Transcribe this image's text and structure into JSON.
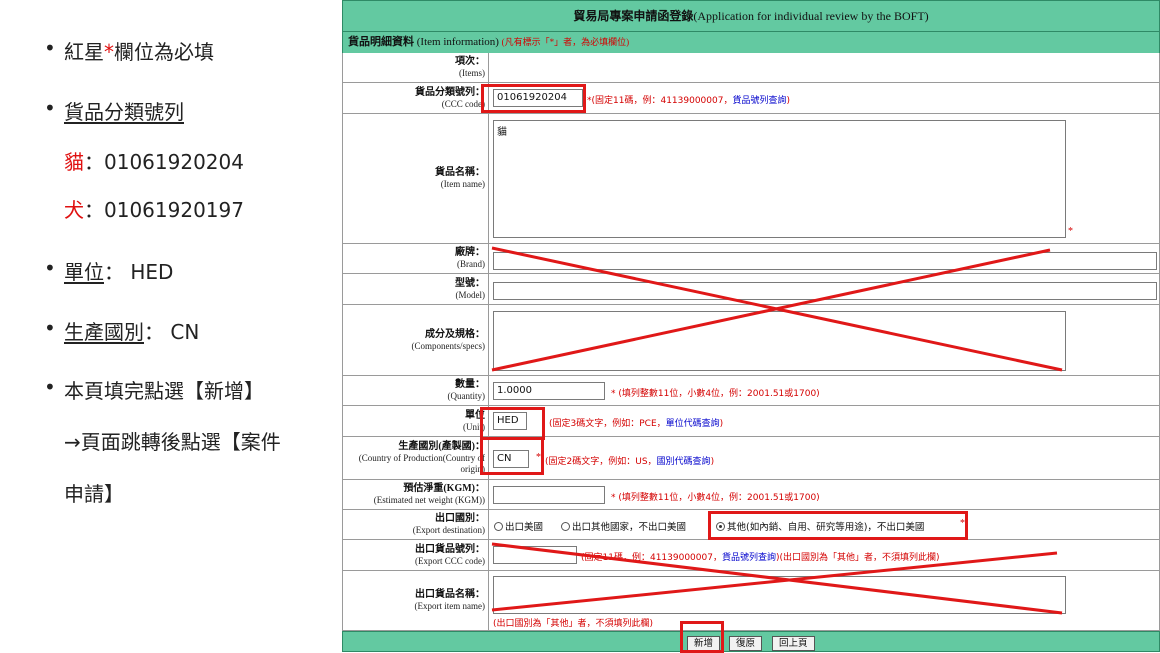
{
  "left": {
    "b1_prefix": "紅星",
    "b1_star": "*",
    "b1_suffix": "欄位為必填",
    "b2": "貨品分類號列",
    "cat_label": "貓",
    "cat_value": "：01061920204",
    "dog_label": "犬",
    "dog_value": "：01061920197",
    "b3_label": "單位",
    "b3_value": "： HED",
    "b4_label": "生產國別",
    "b4_value": "： CN",
    "b5_line1": "本頁填完點選【新增】",
    "b5_line2": "→頁面跳轉後點選【案件",
    "b5_line3": "申請】"
  },
  "form": {
    "title_zh": "貿易局專案申請函登錄",
    "title_en": "(Application for individual review by the BOFT)",
    "section_zh": "貨品明細資料",
    "section_en": "(Item information)",
    "section_note": "(凡有標示「*」者，為必填欄位)",
    "items": {
      "zh": "項次：",
      "en": "(Items)"
    },
    "ccc": {
      "zh": "貨品分類號列：",
      "en": "(CCC code)",
      "value": "01061920204",
      "hint": "*(固定11碼，例：41139000007，",
      "hint_link": "貨品號列查詢",
      "hint_end": ")"
    },
    "item_name": {
      "zh": "貨品名稱：",
      "en": "(Item name)",
      "value": "貓"
    },
    "brand": {
      "zh": "廠牌：",
      "en": "(Brand)"
    },
    "model": {
      "zh": "型號：",
      "en": "(Model)"
    },
    "specs": {
      "zh": "成分及規格：",
      "en": "(Components/specs)"
    },
    "quantity": {
      "zh": "數量：",
      "en": "(Quantity)",
      "value": "1.0000",
      "hint": "* (填列整數11位，小數4位，例：2001.51或1700)"
    },
    "unit": {
      "zh": "單位",
      "en": "(Unit)",
      "value": "HED",
      "hint": "(固定3碼文字，例如：PCE，",
      "hint_link": "單位代碼查詢",
      "hint_end": ")"
    },
    "country": {
      "zh": "生產國別(產製國)：",
      "en1": "(Country of Production(Country of",
      "en2": "origin)",
      "value": "CN",
      "hint": "(固定2碼文字，例如：US，",
      "hint_link": "國別代碼查詢",
      "hint_end": ")"
    },
    "weight": {
      "zh": "預估淨重(KGM)：",
      "en": "(Estimated net weight (KGM))",
      "hint": "* (填列整數11位，小數4位，例：2001.51或1700)"
    },
    "export_dest": {
      "zh": "出口國別：",
      "en": "(Export destination)",
      "opt1": "出口美國",
      "opt2": "出口其他國家，不出口美國",
      "opt3": "其他(如內銷、自用、研究等用途)，不出口美國"
    },
    "export_ccc": {
      "zh": "出口貨品號列：",
      "en": "(Export CCC code)",
      "hint": "(固定11碼，例：41139000007，",
      "hint_link": "貨品號列查詢",
      "hint_end": ")(出口國別為「其他」者，不須填列此欄)"
    },
    "export_name": {
      "zh": "出口貨品名稱：",
      "en": "(Export item name)",
      "hint": "(出口國別為「其他」者，不須填列此欄)"
    },
    "btn_add": "新增",
    "btn_reset": "復原",
    "btn_back": "回上頁",
    "required_mark": "*"
  }
}
